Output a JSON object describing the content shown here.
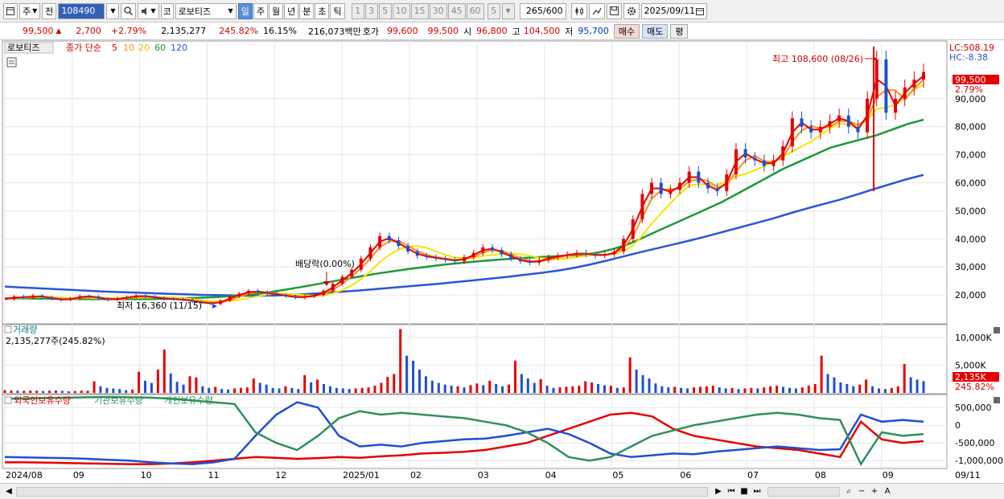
{
  "toolbar": {
    "market_type": "주",
    "prev_label": "전",
    "stock_code": "108490",
    "stock_prefix": "코",
    "stock_name": "로보티즈",
    "periods": [
      "일",
      "주",
      "월",
      "년",
      "분",
      "초",
      "틱"
    ],
    "active_period": "일",
    "intervals": [
      "1",
      "3",
      "5",
      "10",
      "15",
      "30",
      "45",
      "60"
    ],
    "interval_value": "5",
    "count": "265",
    "count_max": "/600",
    "date": "2025/09/11"
  },
  "quote": {
    "price": "99,500",
    "change": "2,700",
    "change_pct": "+2.79%",
    "volume": "2,135,277",
    "volume_ratio": "245.82%",
    "turnover": "16.15%",
    "amount": "216,073백만",
    "bid_label": "호가",
    "bid": "99,600",
    "ask": "99,500",
    "open_label": "시",
    "open": "96,800",
    "high_label": "고",
    "high": "104,500",
    "low_label": "저",
    "low": "95,700",
    "buy_label": "매수",
    "sell_label": "매도",
    "eval_label": "평"
  },
  "legend": {
    "stock": "로보티즈",
    "ma_title": "종가 단순",
    "ma5": "5",
    "ma10": "10",
    "ma20": "20",
    "ma60": "60",
    "ma120": "120"
  },
  "right_axis": {
    "lc": "LC:508.19",
    "hc": "HC:-8.38",
    "current_price": "99,500",
    "current_pct": "2.79%",
    "volume_current": "2,135K",
    "volume_pct": "245.82%"
  },
  "annotations": {
    "high": "최고 108,600 (08/26)",
    "low": "최저 16,360 (11/15)",
    "dividend": "배당락(0.00%)"
  },
  "volume_panel": {
    "title": "거래량",
    "value": "2,135,277주(245.82%)"
  },
  "holding_panel": {
    "foreign": "외국인보유수량",
    "institution": "기관보유수량",
    "individual": "개인보유수량"
  },
  "colors": {
    "up": "#e60000",
    "down": "#1f4fd1",
    "ma5": "#e60000",
    "ma10": "#ff8c1a",
    "ma20": "#f5e400",
    "ma60": "#1a9a3a",
    "ma120": "#2a55d8"
  },
  "chart_data": [
    {
      "type": "candlestick",
      "title": "로보티즈",
      "x_dates": [
        "2024/08",
        "09",
        "10",
        "11",
        "12",
        "2025/01",
        "02",
        "03",
        "04",
        "05",
        "06",
        "07",
        "08",
        "09",
        "09/11"
      ],
      "y_ticks": [
        20000,
        30000,
        40000,
        50000,
        60000,
        70000,
        80000,
        90000
      ],
      "y_tick_labels": [
        "20,000",
        "30,000",
        "40,000",
        "50,000",
        "60,000",
        "70,000",
        "80,000",
        "90,000"
      ],
      "ylim": [
        10000,
        110000
      ],
      "close_path": [
        18500,
        19500,
        19000,
        19800,
        19200,
        18500,
        18200,
        18800,
        19600,
        19400,
        18700,
        18200,
        18800,
        19300,
        19800,
        19400,
        18900,
        18600,
        18500,
        18200,
        17600,
        17200,
        16800,
        18000,
        19500,
        20500,
        21500,
        21000,
        20500,
        20000,
        19500,
        19000,
        19500,
        20000,
        21500,
        24000,
        26500,
        29000,
        33000,
        37000,
        41000,
        39500,
        37500,
        35500,
        34000,
        33500,
        33000,
        32500,
        32000,
        33500,
        35000,
        37000,
        36000,
        34500,
        33000,
        32000,
        31500,
        32500,
        33500,
        34000,
        34500,
        35000,
        34500,
        34000,
        34500,
        35500,
        40000,
        47000,
        56000,
        60000,
        56000,
        57500,
        60000,
        64000,
        60000,
        58000,
        57000,
        63000,
        72000,
        69000,
        68000,
        66000,
        68000,
        73000,
        83000,
        80000,
        78000,
        80000,
        82000,
        84000,
        80000,
        78000,
        90000,
        104000,
        85000,
        90000,
        94000,
        96800,
        99500
      ],
      "ma60_path": [
        18800,
        18800,
        18700,
        18700,
        18600,
        18500,
        18500,
        18500,
        18500,
        18500,
        18600,
        18700,
        18900,
        19100,
        19400,
        19800,
        20300,
        21000,
        21900,
        22800,
        23800,
        24800,
        25800,
        26800,
        27700,
        28500,
        29300,
        30000,
        30700,
        31300,
        31800,
        32300,
        32700,
        33100,
        33400,
        33700,
        34000,
        34300,
        35000,
        36300,
        38000,
        40500,
        43000,
        45500,
        48000,
        50500,
        53000,
        56000,
        59000,
        62000,
        65000,
        67500,
        70000,
        72500,
        74000,
        75500,
        77000,
        79000,
        81000,
        82500
      ],
      "ma120_path": [
        23000,
        22700,
        22400,
        22100,
        21800,
        21500,
        21200,
        21000,
        20800,
        20600,
        20400,
        20200,
        20000,
        19900,
        19800,
        19700,
        19800,
        20000,
        20300,
        20700,
        21100,
        21500,
        22000,
        22500,
        23000,
        23500,
        24000,
        24600,
        25200,
        25800,
        26400,
        27100,
        27800,
        28600,
        29600,
        30800,
        32200,
        33700,
        35200,
        36600,
        38000,
        39400,
        40900,
        42500,
        44100,
        45700,
        47300,
        49100,
        50800,
        52400,
        54000,
        55800,
        57700,
        59500,
        61300,
        62800
      ],
      "high": 108600,
      "low": 16360
    },
    {
      "type": "bar",
      "title": "거래량",
      "y_ticks": [
        5000,
        10000
      ],
      "y_tick_labels": [
        "5,000K",
        "10,000K"
      ],
      "ylim": [
        0,
        12000
      ],
      "values_k": [
        500,
        450,
        400,
        380,
        420,
        390,
        350,
        400,
        450,
        380,
        300,
        350,
        420,
        380,
        2100,
        1200,
        900,
        800,
        700,
        500,
        600,
        3800,
        2200,
        1800,
        4200,
        7800,
        3500,
        2000,
        1500,
        3000,
        2800,
        1200,
        900,
        1100,
        700,
        600,
        800,
        900,
        1000,
        2600,
        1800,
        1500,
        900,
        800,
        1200,
        900,
        700,
        3200,
        1900,
        2400,
        1600,
        1200,
        900,
        800,
        700,
        800,
        900,
        1000,
        1300,
        1800,
        2900,
        3400,
        11500,
        6700,
        5800,
        4200,
        3000,
        2200,
        1800,
        1500,
        1300,
        1200,
        1000,
        1400,
        1700,
        1400,
        2200,
        1600,
        1200,
        1500,
        5800,
        3400,
        2600,
        1800,
        2500,
        1300,
        900,
        1000,
        1100,
        1200,
        1300,
        2100,
        1900,
        1600,
        1400,
        1300,
        900,
        1000,
        6400,
        4200,
        3200,
        2600,
        1700,
        1200,
        1000,
        1100,
        900,
        800,
        1000,
        1100,
        1200,
        1300,
        1000,
        800,
        900,
        700,
        800,
        900,
        800,
        1000,
        1200,
        1300,
        1100,
        900,
        800,
        1000,
        1300,
        1600,
        6700,
        3400,
        2800,
        1900,
        1600,
        1200,
        1500,
        2400,
        1200,
        800,
        700,
        900,
        1200,
        5200,
        2800,
        2400,
        2135
      ]
    },
    {
      "type": "line",
      "title": "외국인보유수량 / 기관보유수량 / 개인보유수량",
      "y_ticks": [
        500000,
        0,
        -500000,
        -1000000
      ],
      "y_tick_labels": [
        "500,000",
        "0",
        "-500,000",
        "-1,000,000"
      ],
      "ylim": [
        -1200000,
        800000
      ],
      "series": [
        {
          "name": "외국인보유수량",
          "color": "#e60000",
          "values": [
            -1050000,
            -1050000,
            -1060000,
            -1070000,
            -1080000,
            -1090000,
            -1100000,
            -1100000,
            -1080000,
            -1050000,
            -1000000,
            -950000,
            -900000,
            -920000,
            -950000,
            -930000,
            -900000,
            -920000,
            -880000,
            -850000,
            -800000,
            -780000,
            -750000,
            -700000,
            -600000,
            -500000,
            -300000,
            -100000,
            100000,
            300000,
            350000,
            250000,
            -100000,
            -300000,
            -400000,
            -500000,
            -600000,
            -650000,
            -700000,
            -800000,
            -900000,
            100000,
            -400000,
            -500000,
            -450000
          ]
        },
        {
          "name": "기관보유수량",
          "color": "#1f4fd1",
          "values": [
            -900000,
            -910000,
            -920000,
            -930000,
            -950000,
            -980000,
            -1000000,
            -1050000,
            -1080000,
            -1100000,
            -1050000,
            -950000,
            -300000,
            300000,
            650000,
            500000,
            -300000,
            -600000,
            -550000,
            -600000,
            -500000,
            -450000,
            -400000,
            -380000,
            -300000,
            -200000,
            -100000,
            -250000,
            -500000,
            -800000,
            -900000,
            -850000,
            -800000,
            -820000,
            -750000,
            -700000,
            -650000,
            -600000,
            -650000,
            -700000,
            -680000,
            300000,
            100000,
            150000,
            100000
          ]
        },
        {
          "name": "개인보유수량",
          "color": "#2f8f5a",
          "values": [
            750000,
            760000,
            770000,
            780000,
            790000,
            800000,
            790000,
            780000,
            750000,
            700000,
            650000,
            600000,
            -200000,
            -500000,
            -700000,
            -300000,
            200000,
            400000,
            300000,
            350000,
            300000,
            250000,
            200000,
            100000,
            0,
            -200000,
            -500000,
            -900000,
            -1000000,
            -900000,
            -600000,
            -300000,
            -150000,
            0,
            100000,
            200000,
            300000,
            350000,
            300000,
            200000,
            150000,
            -1100000,
            -200000,
            -300000,
            -250000
          ]
        }
      ]
    }
  ]
}
